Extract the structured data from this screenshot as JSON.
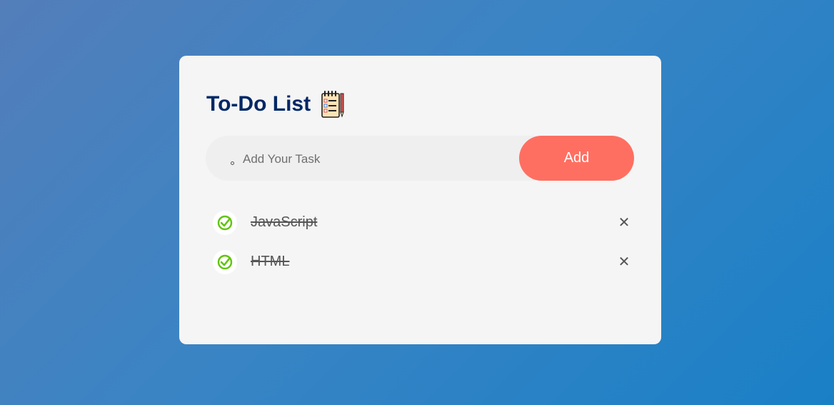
{
  "app": {
    "title": "To-Do List",
    "title_icon": "notepad-icon"
  },
  "input": {
    "placeholder": "Add Your Task",
    "value": ""
  },
  "add_button": {
    "label": "Add",
    "color": "#ff6f61"
  },
  "tasks": [
    {
      "label": "JavaScript",
      "checked": true,
      "delete_symbol": "✕"
    },
    {
      "label": "HTML",
      "checked": true,
      "delete_symbol": "✕"
    }
  ],
  "colors": {
    "title": "#002765",
    "check": "#62c30d",
    "card": "#f5f5f5"
  }
}
